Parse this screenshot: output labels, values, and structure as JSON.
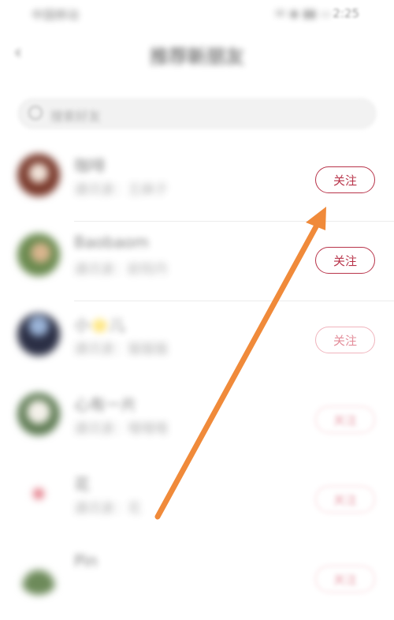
{
  "status_bar": {
    "left_text": "中国移动",
    "right_icons": "✉ ◉ ▮▮ ▭",
    "time": "2:25"
  },
  "navbar": {
    "back_label": "‹",
    "title": "推荐新朋友"
  },
  "search": {
    "placeholder": "搜索好友"
  },
  "users": [
    {
      "name": "咖啡",
      "subtitle": "通讯录：王麻子",
      "follow_label": "关注",
      "avatar_color": "#7a3a2c"
    },
    {
      "name": "Baobaom",
      "subtitle": "通讯录：欧阳丹",
      "follow_label": "关注",
      "avatar_color": "#6a8a4f"
    },
    {
      "name": "小🌟儿",
      "subtitle": "通讯录：猫猫猫",
      "follow_label": "关注",
      "avatar_color": "#2b2f45"
    },
    {
      "name": "心有一片",
      "subtitle": "通讯录：嘻嘻嘻",
      "follow_label": "关注",
      "avatar_color": "#5d7a52"
    },
    {
      "name": "花",
      "subtitle": "通讯录：花",
      "follow_label": "关注",
      "avatar_color": "#e06a78"
    },
    {
      "name": "Pin",
      "subtitle": "",
      "follow_label": "关注",
      "avatar_color": "#6d8a5a"
    }
  ],
  "annotation": {
    "arrow_color": "#f08a3a"
  }
}
